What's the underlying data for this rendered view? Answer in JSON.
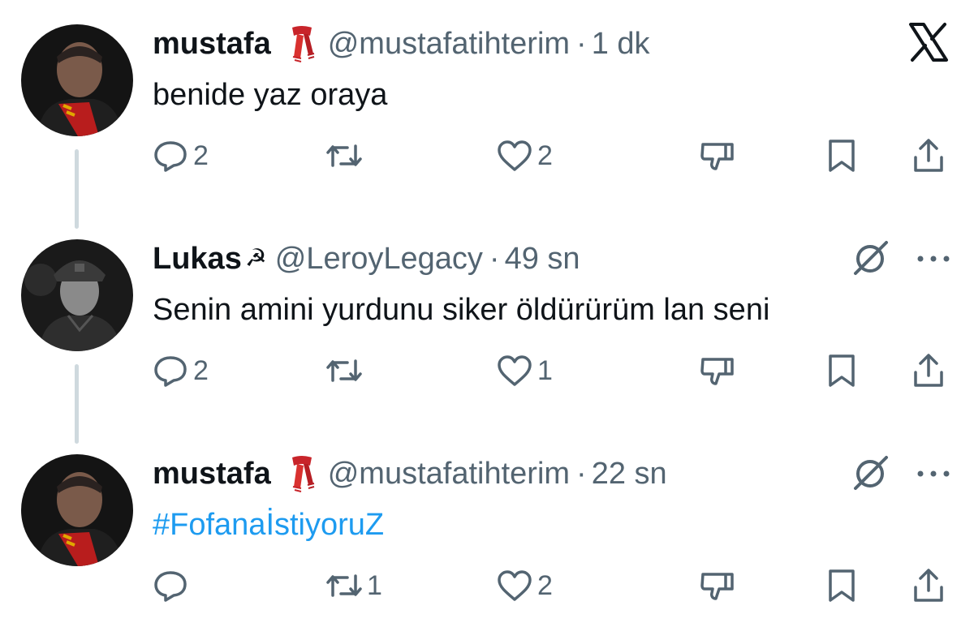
{
  "tweets": [
    {
      "name": "mustafa",
      "emoji": "scarf-emoji",
      "handle": "@mustafatihterim",
      "time": "1 dk",
      "text": "benide yaz oraya",
      "counts": {
        "reply": "2",
        "retweet": "",
        "like": "2"
      },
      "corner": "x-logo-icon"
    },
    {
      "name": "Lukas",
      "emoji": "☭",
      "handle": "@LeroyLegacy",
      "time": "49 sn",
      "text": "Senin amini yurdunu siker öldürürüm lan seni",
      "counts": {
        "reply": "2",
        "retweet": "",
        "like": "1"
      },
      "corner": "grok-icon"
    },
    {
      "name": "mustafa",
      "emoji": "scarf-emoji",
      "handle": "@mustafatihterim",
      "time": "22 sn",
      "text": "#FofanaİstiyoruZ",
      "counts": {
        "reply": "",
        "retweet": "1",
        "like": "2"
      },
      "corner": "grok-icon"
    }
  ],
  "separator": "·",
  "colors": {
    "text": "#0f1419",
    "muted": "#536471",
    "link": "#1d9bf0",
    "line": "#cfd9de"
  }
}
